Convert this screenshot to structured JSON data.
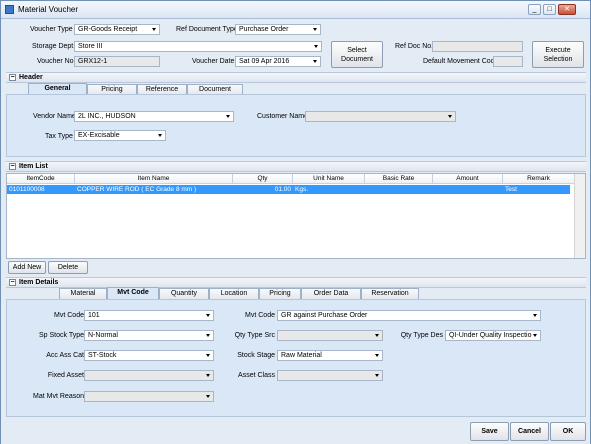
{
  "window": {
    "title": "Material Voucher",
    "min": "_",
    "max": "□",
    "close": "✕"
  },
  "top": {
    "voucher_type_label": "Voucher Type",
    "voucher_type": "GR-Goods Receipt",
    "ref_doc_type_label": "Ref Document Type",
    "ref_doc_type": "Purchase Order",
    "storage_dept_label": "Storage Dept.",
    "storage_dept": "Store III",
    "voucher_no_label": "Voucher No.",
    "voucher_no": "GRX12-1",
    "voucher_date_label": "Voucher Date",
    "voucher_date": "Sat 09 Apr 2016",
    "select_document": "Select Document",
    "ref_doc_no_label": "Ref Doc No.",
    "ref_doc_no": "",
    "default_mvt_label": "Default Movement Code",
    "default_mvt": "",
    "execute_selection": "Execute Selection"
  },
  "header": {
    "title": "Header",
    "tabs": [
      "General",
      "Pricing",
      "Reference",
      "Document"
    ],
    "vendor_label": "Vendor Name",
    "vendor": "2L INC., HUDSON",
    "customer_label": "Customer Name",
    "customer": "",
    "tax_type_label": "Tax Type",
    "tax_type": "EX-Excisable"
  },
  "item_list": {
    "title": "Item List",
    "columns": [
      "ItemCode",
      "Item Name",
      "Qty",
      "Unit Name",
      "Basic Rate",
      "Amount",
      "Remark"
    ],
    "rows": [
      {
        "code": "0101100008",
        "name": "COPPER WIRE ROD ( EC Grade    8 mm )",
        "qty": "01.00",
        "unit": "Kgs.",
        "rate": "",
        "amount": "",
        "remark": "Test"
      }
    ],
    "add_new": "Add New",
    "delete": "Delete"
  },
  "item_details": {
    "title": "Item Details",
    "tabs": [
      "Material",
      "Mvt Code",
      "Quantity",
      "Location",
      "Pricing",
      "Order Data",
      "Reservation"
    ],
    "mvt_code_left_label": "Mvt Code",
    "mvt_code_left": "101",
    "sp_stock_label": "Sp Stock Type",
    "sp_stock": "N-Normal",
    "acc_ass_label": "Acc Ass Cat",
    "acc_ass": "ST-Stock",
    "fixed_asset_label": "Fixed Asset",
    "fixed_asset": "",
    "mat_mvt_reason_label": "Mat Mvt Reason",
    "mat_mvt_reason": "",
    "mvt_code_right_label": "Mvt Code",
    "mvt_code_right": "GR against Purchase Order",
    "qty_type_src_label": "Qty Type Src",
    "qty_type_src": "",
    "qty_type_des_label": "Qty Type Des",
    "qty_type_des": "QI-Under Quality Inspectio",
    "stock_stage_label": "Stock Stage",
    "stock_stage": "Raw Material",
    "asset_class_label": "Asset Class",
    "asset_class": ""
  },
  "footer": {
    "save": "Save",
    "cancel": "Cancel",
    "ok": "OK"
  }
}
